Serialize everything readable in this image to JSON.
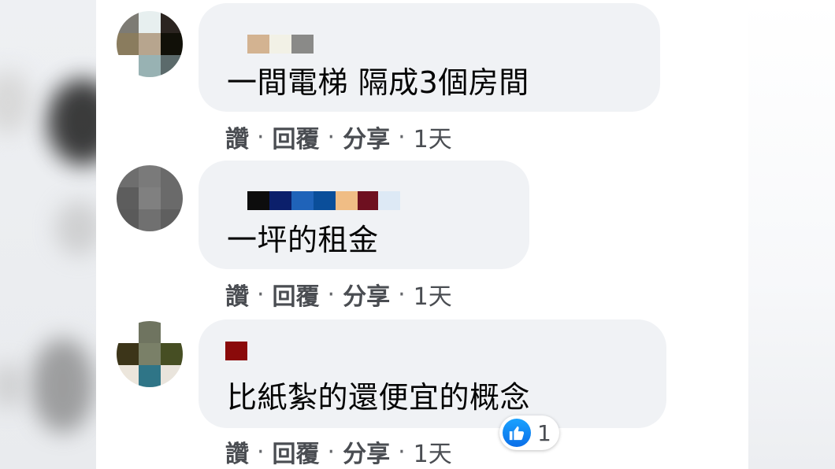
{
  "comments": [
    {
      "text": "一間電梯 隔成3個房間",
      "actions": {
        "like": "讚",
        "reply": "回覆",
        "share": "分享",
        "time": "1天"
      },
      "avatar_colors": [
        "#7d7b74",
        "#e7efef",
        "#2b2420",
        "#8a7c5e",
        "#b7a58e",
        "#111008",
        "#ffffff",
        "#98b2b3",
        "#5b6a6b"
      ],
      "name_colors": [
        "#d3b391",
        "#f2f1e6",
        "#8a8a88"
      ]
    },
    {
      "text": "一坪的租金",
      "actions": {
        "like": "讚",
        "reply": "回覆",
        "share": "分享",
        "time": "1天"
      },
      "avatar_colors": [
        "#6e6e6e",
        "#7a7a7a",
        "#6a6a6a",
        "#5d5d5d",
        "#808080",
        "#6a6a6a",
        "#5a5a5a",
        "#707070",
        "#5f5f5f"
      ],
      "name_colors": [
        "#0d0d0d",
        "#0b1f6b",
        "#1f63b9",
        "#0a4e9a",
        "#f0bd85",
        "#6e1020",
        "#dde9f5"
      ]
    },
    {
      "text": "比紙紮的還便宜的概念",
      "actions": {
        "like": "讚",
        "reply": "回覆",
        "share": "分享",
        "time": "1天"
      },
      "avatar_colors": [
        "#ffffff",
        "#6f7460",
        "#ffffff",
        "#3c3519",
        "#7a8068",
        "#464e23",
        "#ece6dc",
        "#2f7587",
        "#e9e4dc"
      ],
      "name_colors": [
        "#8a0a0a"
      ],
      "reaction": {
        "icon": "thumbs-up-icon",
        "count": "1",
        "color": "#1877f2"
      }
    }
  ]
}
